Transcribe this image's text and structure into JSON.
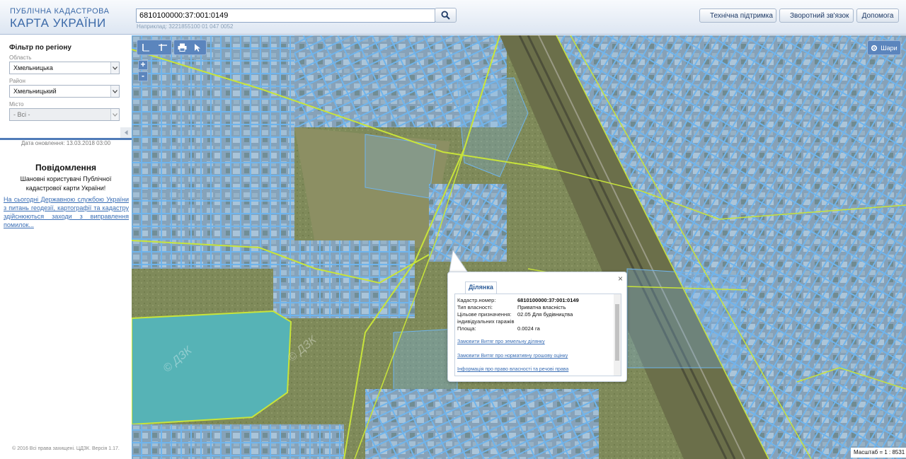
{
  "header": {
    "logo_line1": "ПУБЛІЧНА КАДАСТРОВА",
    "logo_line2": "КАРТА УКРАЇНИ",
    "search_value": "6810100000:37:001:0149",
    "search_hint": "Наприклад: 3221855100 01 047 0052",
    "buttons": [
      {
        "label": "Технічна підтримка",
        "icon": "tools-icon"
      },
      {
        "label": "Зворотний зв'язок",
        "icon": "envelope-icon"
      },
      {
        "label": "Допомога",
        "icon": ""
      }
    ]
  },
  "sidebar": {
    "filter_title": "Фільтр по регіону",
    "region_label": "Область",
    "region_value": "Хмельницька",
    "district_label": "Район",
    "district_value": "Хмельницький",
    "city_label": "Місто",
    "city_value": "- Всі -",
    "updated": "Дата оновлення: 13.03.2018 03:00",
    "notice_title": "Повідомлення",
    "notice_text": "Шановні користувачі Публічної кадастрової карти України!",
    "notice_link": "На сьогодні Державною службою України з питань геодезії, картографії та кадастру здійснюються заходи з виправлення помилок...",
    "copyright": "© 2016 Всі права захищені. ЦДЗК. Версія 1.17."
  },
  "map": {
    "layers_label": "Шари",
    "zoom_in": "+",
    "zoom_out": "-",
    "scale_text": "Масштаб = 1 : 8531",
    "watermark": "© ДЗК",
    "colors": {
      "parcel": "#6fb4ec",
      "boundary": "#c8e43a",
      "tool": "#5b85bd"
    }
  },
  "popup": {
    "tab": "Ділянка",
    "close": "×",
    "rows": [
      {
        "label": "Кадастр.номер:",
        "value": "6810100000:37:001:0149"
      },
      {
        "label": "Тип власності:",
        "value": "Приватна власність"
      },
      {
        "label": "Цільове призначення:",
        "value": "02.05 Для будівництва"
      },
      {
        "label": "",
        "value": "індивідуальних гаражів"
      },
      {
        "label": "Площа:",
        "value": "0.0024 га"
      }
    ],
    "links": [
      "Замовити Витяг про земельну ділянку",
      "Замовити Витяг про нормативну грошову оцінку",
      "Інформація про право власності та речові права"
    ]
  }
}
